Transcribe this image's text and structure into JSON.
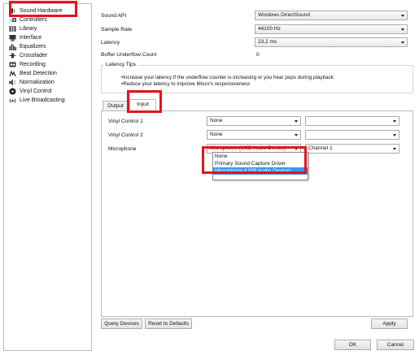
{
  "sidebar": {
    "items": [
      {
        "label": "Sound Hardware",
        "icon": "speaker-icon"
      },
      {
        "label": "Controllers",
        "icon": "controller-icon"
      },
      {
        "label": "Library",
        "icon": "library-icon"
      },
      {
        "label": "Interface",
        "icon": "monitor-icon"
      },
      {
        "label": "Equalizers",
        "icon": "equalizer-icon"
      },
      {
        "label": "Crossfader",
        "icon": "crossfader-icon"
      },
      {
        "label": "Recording",
        "icon": "record-icon"
      },
      {
        "label": "Beat Detection",
        "icon": "beat-detection-icon"
      },
      {
        "label": "Normalization",
        "icon": "normalization-icon"
      },
      {
        "label": "Vinyl Control",
        "icon": "vinyl-icon"
      },
      {
        "label": "Live Broadcasting",
        "icon": "broadcast-icon"
      }
    ]
  },
  "sound_api": {
    "label": "Sound API",
    "value": "Windows DirectSound"
  },
  "sample_rate": {
    "label": "Sample Rate",
    "value": "44100 Hz"
  },
  "latency": {
    "label": "Latency",
    "value": "23.2 ms"
  },
  "buffer_underflow": {
    "label": "Buffer Underflow Count",
    "value": "0"
  },
  "latency_tips": {
    "title": "Latency Tips",
    "tips": [
      "•Increase your latency if the underflow counter is increasing or you hear pops during playback",
      "•Reduce your latency to improve Mixxx's responsiveness"
    ]
  },
  "tabs": [
    {
      "label": "Output",
      "active": false
    },
    {
      "label": "Input",
      "active": true
    }
  ],
  "input": {
    "rows": [
      {
        "label": "Vinyl Control 1",
        "device": "None",
        "channel": ""
      },
      {
        "label": "Vinyl Control 2",
        "device": "None",
        "channel": ""
      },
      {
        "label": "Microphone",
        "device": "Microphone (USB Audio Device)",
        "channel": "Channel 1"
      }
    ],
    "device_options": [
      {
        "label": "None",
        "selected": false
      },
      {
        "label": "Primary Sound Capture Driver",
        "selected": false
      },
      {
        "label": "Microphone (USB Audio Device)",
        "selected": true
      }
    ]
  },
  "buttons": {
    "query_devices": "Query Devices",
    "reset_defaults": "Reset to Defaults",
    "apply": "Apply",
    "ok": "OK",
    "cancel": "Cancel"
  },
  "colors": {
    "highlight_box": "#e4141b",
    "selection": "#3399ff"
  }
}
